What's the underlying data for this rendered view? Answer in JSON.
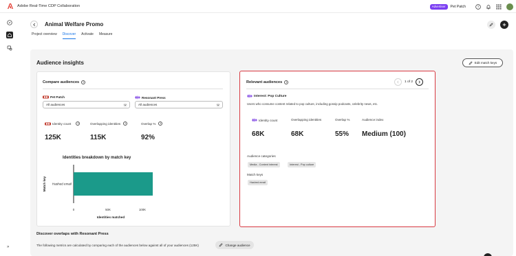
{
  "app": {
    "title": "Adobe Real-Time CDP Collaboration",
    "badge": "Advertiser",
    "org": "Pet Patch",
    "icons": [
      "help-icon",
      "bell-icon",
      "apps-grid-icon",
      "avatar"
    ]
  },
  "rail": {
    "icons": [
      "compass-icon",
      "home-icon",
      "audience-icon"
    ],
    "expand_glyph": "»"
  },
  "page": {
    "title": "Animal Welfare Promo",
    "tabs": [
      {
        "label": "Project overview",
        "active": false
      },
      {
        "label": "Discover",
        "active": true
      },
      {
        "label": "Activate",
        "active": false
      },
      {
        "label": "Measure",
        "active": false
      }
    ]
  },
  "insights": {
    "title": "Audience insights",
    "edit_match_keys": "Edit match keys"
  },
  "compare": {
    "title": "Compare audiences",
    "left_org": "Pet Patch",
    "right_org": "Resonant Press",
    "left_select": "All audiences",
    "right_select": "All audiences",
    "metrics": [
      {
        "label": "Identity count",
        "value": "125K"
      },
      {
        "label": "Overlapping identities",
        "value": "115K"
      },
      {
        "label": "Overlap %",
        "value": "92%"
      }
    ]
  },
  "chart_data": {
    "type": "bar",
    "orientation": "horizontal",
    "title": "Identities breakdown by match key",
    "xlabel": "Identities matched",
    "ylabel": "Match key",
    "categories": [
      "Hashed email"
    ],
    "values": [
      115000
    ],
    "xlim": [
      0,
      115000
    ],
    "xticks": [
      "0",
      "50K",
      "100K"
    ],
    "color": "#1b9a8a"
  },
  "relevant": {
    "title": "Relevant audiences",
    "pager": "1 of 2",
    "audience_name": "Interest: Pop Culture",
    "description": "Users who consume content related to pop culture, including gossip podcasts, celebrity news, etc.",
    "metrics": [
      {
        "label": "Identity count",
        "value": "68K"
      },
      {
        "label": "Overlapping identities",
        "value": "68K"
      },
      {
        "label": "Overlap %",
        "value": "55%"
      },
      {
        "label": "Audience index",
        "value": "Medium (100)"
      }
    ],
    "categories_label": "Audience categories",
    "categories": [
      "Media - Content interest",
      "Interest - Pop culture"
    ],
    "match_keys_label": "Match keys",
    "match_keys": [
      "Hashed email"
    ]
  },
  "bottom": {
    "title": "Discover overlaps with Resonant Press",
    "desc": "The following metrics are calculated by comparing each of the audiences below against all of your audiences (125K)",
    "change_audience": "Change audience"
  },
  "colors": {
    "accent": "#1473e6",
    "badge": "#7b3ff2",
    "highlight_border": "#d7373f",
    "bar": "#1b9a8a",
    "resonant_logo": "#8a55e6"
  }
}
